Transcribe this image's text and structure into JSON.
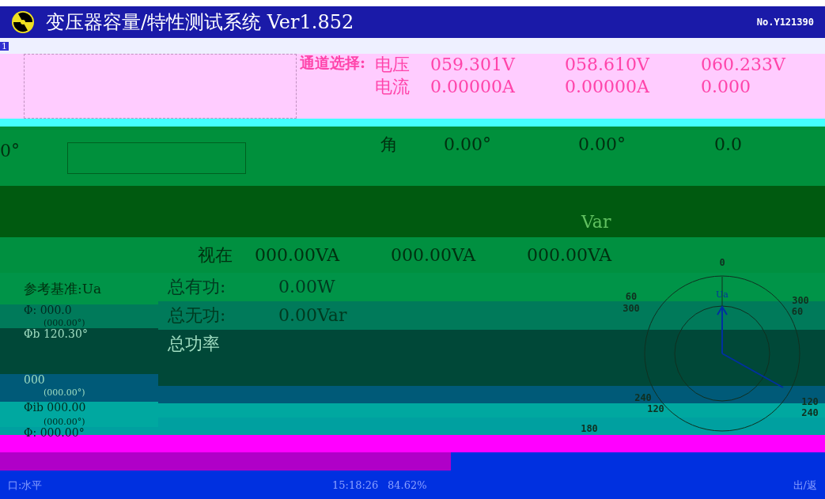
{
  "window": {
    "title": "变压器容量/特性测试系统 Ver1.852",
    "serial": "No.Y121390",
    "page_number": "1"
  },
  "channel_panel": {
    "label": "通道选择:",
    "rows": [
      {
        "name": "电压",
        "values": [
          "059.301V",
          "058.610V",
          "060.233V"
        ]
      },
      {
        "name": "电流",
        "values": [
          "0.00000A",
          "0.00000A",
          "0.000"
        ]
      }
    ]
  },
  "angle_row": {
    "left_value": "0°",
    "name": "角",
    "values": [
      "0.00°",
      "0.00°",
      "0.0"
    ]
  },
  "reactive_row": {
    "unit": "Var"
  },
  "apparent_row": {
    "name": "视在",
    "values": [
      "000.00VA",
      "000.00VA",
      "000.00VA"
    ]
  },
  "reference": {
    "label": "参考基准:Ua",
    "lines": [
      "Φ: 000.0",
      "(000.00°)",
      "Φb 120.30°",
      "000",
      "(000.00°)",
      "Φib 000.00",
      "(000.00°)",
      "Φ: 000.00°"
    ]
  },
  "totals": [
    {
      "label": "总有功:",
      "value": "0.00W"
    },
    {
      "label": "总无功:",
      "value": "0.00Var"
    },
    {
      "label": "总功率"
    }
  ],
  "phasor_dial": {
    "vector_label": "Ua",
    "labels": [
      "0",
      "60",
      "300",
      "300",
      "60",
      "240",
      "120",
      "120",
      "240",
      "180"
    ]
  },
  "status_bar": [
    "口:水平",
    "15:18:26",
    "84.62%",
    "出/返"
  ]
}
